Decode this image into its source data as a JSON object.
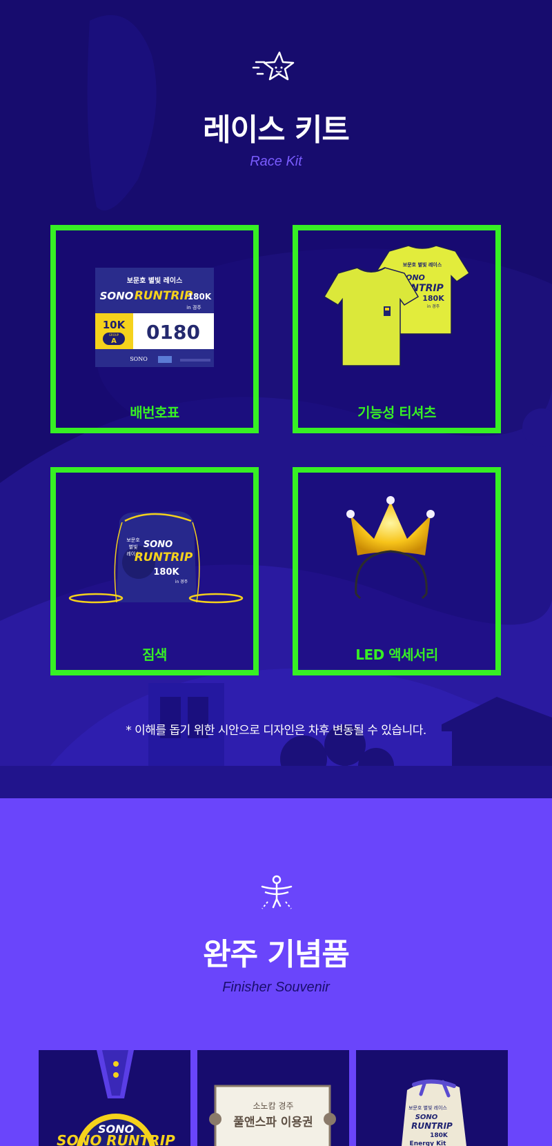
{
  "race_kit": {
    "title": "레이스 키트",
    "subtitle": "Race Kit",
    "items": [
      {
        "label": "배번호표",
        "icon": "bib-number-image"
      },
      {
        "label": "기능성 티셔츠",
        "icon": "tshirt-image"
      },
      {
        "label": "짐색",
        "icon": "drawstring-bag-image"
      },
      {
        "label": "LED 액세서리",
        "icon": "led-crown-headband-image"
      }
    ],
    "bib": {
      "event_line": "보문호 별빛 레이스",
      "sono": "SONO",
      "runtrip": "RUNTRIP",
      "distance_total": "180K",
      "location": "in 경주",
      "category": "10K",
      "group_label": "GROUP",
      "group": "A",
      "number": "0180",
      "brand": "SONO"
    },
    "note": "* 이해를 돕기 위한 시안으로 디자인은 차후 변동될 수 있습니다."
  },
  "souvenir": {
    "title": "완주 기념품",
    "subtitle": "Finisher Souvenir",
    "items": [
      {
        "icon": "medal-image",
        "text": "SONO RUNTRIP"
      },
      {
        "icon": "voucher-image",
        "top_line": "소노캄 경주",
        "main_line": "풀앤스파 이용권"
      },
      {
        "icon": "pouch-bag-image",
        "text": "Energy Kit"
      }
    ]
  },
  "colors": {
    "kit_bg": "#170c6e",
    "accent_green": "#37f024",
    "souvenir_bg": "#6a45fb",
    "subtitle_purple": "#7a5cff",
    "brand_yellow": "#f5d21c"
  }
}
